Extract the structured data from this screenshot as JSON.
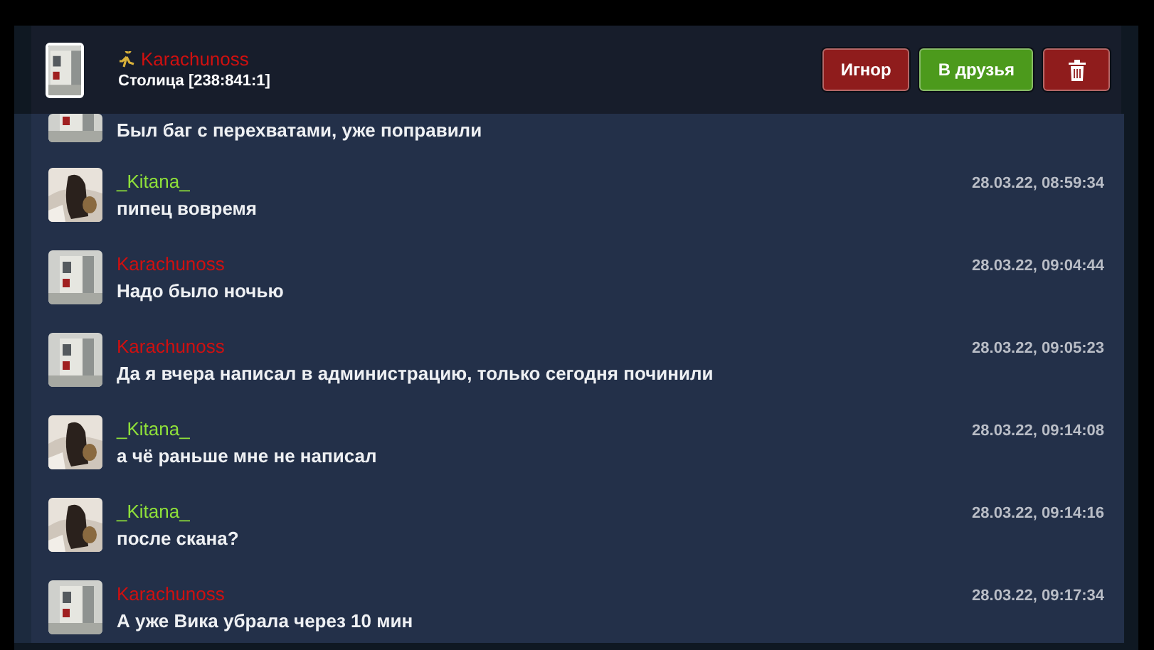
{
  "header": {
    "name": "Karachunoss",
    "color": "#d01010",
    "location": "Столица [238:841:1]",
    "buttons": [
      {
        "kind": "text",
        "label": "Игнор",
        "color": "#8f1c1c"
      },
      {
        "kind": "text",
        "label": "В друзья",
        "color": "#4c9a1c"
      },
      {
        "kind": "delete",
        "color": "#8f1c1c"
      }
    ]
  },
  "messages": [
    {
      "text": "Был баг с перехватами, уже поправили"
    },
    {
      "name": "_Kitana_",
      "color": "#8fe03a",
      "time": "28.03.22, 08:59:34",
      "text": "пипец вовремя"
    },
    {
      "name": "Karachunoss",
      "color": "#d01010",
      "time": "28.03.22, 09:04:44",
      "text": "Надо было ночью"
    },
    {
      "name": "Karachunoss",
      "color": "#d01010",
      "time": "28.03.22, 09:05:23",
      "text": "Да я вчера написал в администрацию, только сегодня починили"
    },
    {
      "name": "_Kitana_",
      "color": "#8fe03a",
      "time": "28.03.22, 09:14:08",
      "text": "а чё раньше мне не написал"
    },
    {
      "name": "_Kitana_",
      "color": "#8fe03a",
      "time": "28.03.22, 09:14:16",
      "text": "после скана?"
    },
    {
      "name": "Karachunoss",
      "color": "#d01010",
      "time": "28.03.22, 09:17:34",
      "text": "А уже Вика убрала через 10 мин"
    }
  ]
}
